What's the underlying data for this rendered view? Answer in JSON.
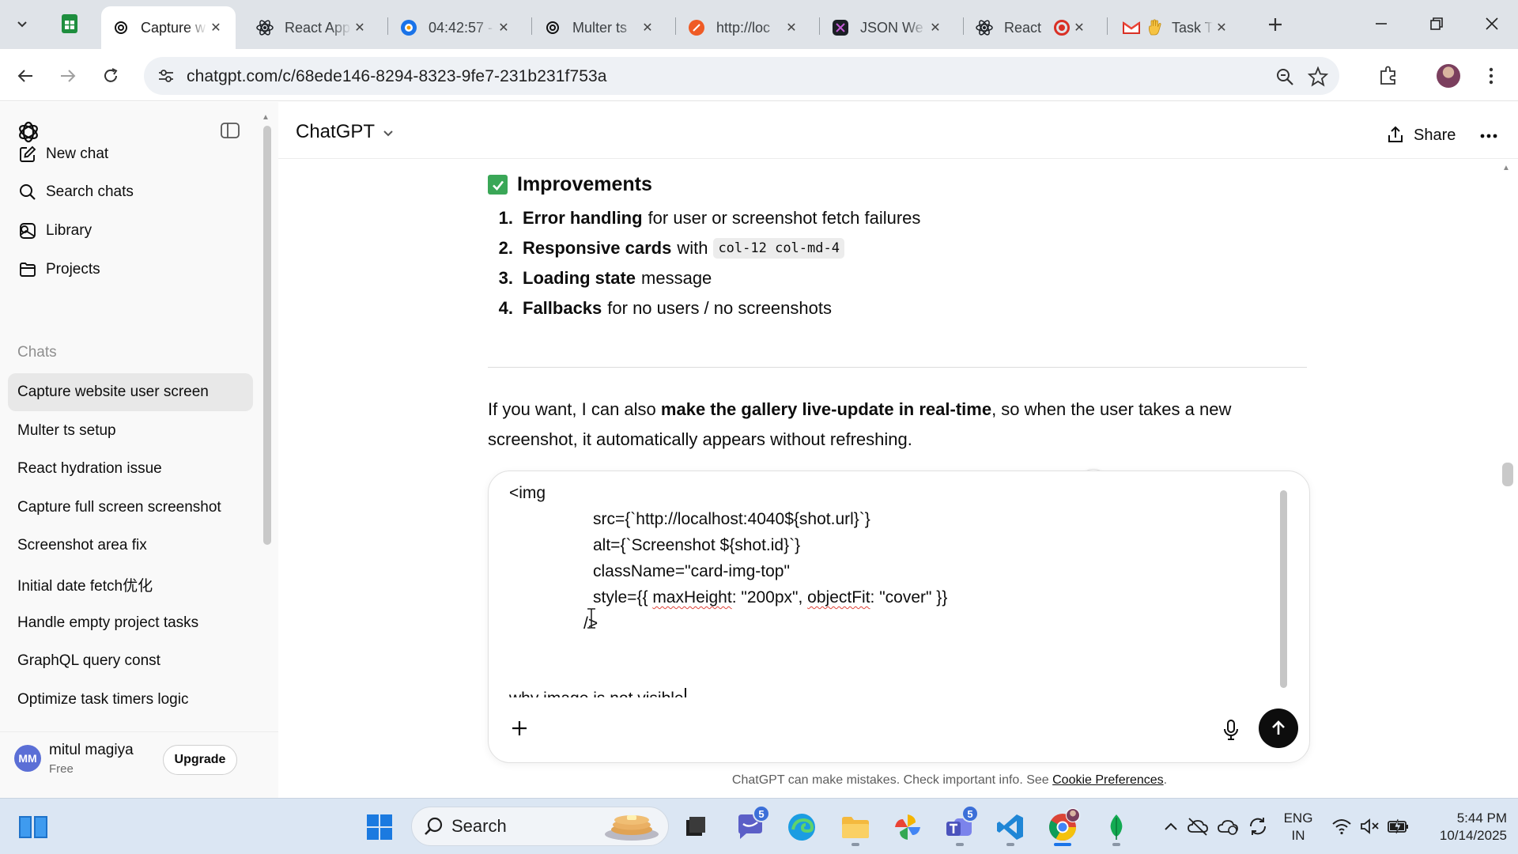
{
  "browser": {
    "tabs": [
      {
        "title": "Capture w",
        "active": true
      },
      {
        "title": "React App",
        "active": false
      },
      {
        "title": "04:42:57 -",
        "active": false
      },
      {
        "title": "Multer ts",
        "active": false
      },
      {
        "title": "http://loc",
        "active": false
      },
      {
        "title": "JSON We",
        "active": false
      },
      {
        "title": "React",
        "active": false
      },
      {
        "title": "Task T",
        "active": false
      }
    ],
    "url": "chatgpt.com/c/68ede146-8294-8323-9fe7-231b231f753a"
  },
  "sidebar": {
    "nav": [
      {
        "label": "New chat",
        "icon": "compose-icon"
      },
      {
        "label": "Search chats",
        "icon": "search-icon"
      },
      {
        "label": "Library",
        "icon": "library-icon"
      },
      {
        "label": "Projects",
        "icon": "folder-icon"
      }
    ],
    "section_label": "Chats",
    "chats": [
      {
        "label": "Capture website user screen",
        "active": true
      },
      {
        "label": "Multer ts setup",
        "active": false
      },
      {
        "label": "React hydration issue",
        "active": false
      },
      {
        "label": "Capture full screen screenshot",
        "active": false
      },
      {
        "label": "Screenshot area fix",
        "active": false
      },
      {
        "label": "Initial date fetch优化",
        "active": false
      },
      {
        "label": "Handle empty project tasks",
        "active": false
      },
      {
        "label": "GraphQL query const",
        "active": false
      },
      {
        "label": "Optimize task timers logic",
        "active": false
      }
    ],
    "user": {
      "initials": "MM",
      "name": "mitul magiya",
      "plan": "Free",
      "upgrade_label": "Upgrade"
    }
  },
  "header": {
    "model": "ChatGPT",
    "share_label": "Share"
  },
  "message": {
    "improvements_heading": "Improvements",
    "items": [
      {
        "num": "1.",
        "bold": "Error handling",
        "rest": "for user or screenshot fetch failures",
        "code": ""
      },
      {
        "num": "2.",
        "bold": "Responsive cards",
        "rest": "with",
        "code": "col-12 col-md-4"
      },
      {
        "num": "3.",
        "bold": "Loading state",
        "rest": "message",
        "code": ""
      },
      {
        "num": "4.",
        "bold": "Fallbacks",
        "rest": "for no users / no screenshots",
        "code": ""
      }
    ],
    "para_pre": "If you want, I can also ",
    "para_bold": "make the gallery live-update in real-time",
    "para_post": ", so when the user takes a new screenshot, it automatically appears without refreshing."
  },
  "composer": {
    "lines": [
      "<img",
      "src={`http://localhost:4040${shot.url}`}",
      "alt={`Screenshot ${shot.id}`}",
      "className=\"card-img-top\"",
      "style={{ ",
      "maxHeight",
      ": \"200px\", ",
      "objectFit",
      ": \"cover\" }}",
      "/>"
    ],
    "question": "why image is not visible"
  },
  "disclaimer": {
    "text": "ChatGPT can make mistakes. Check important info. See ",
    "link": "Cookie Preferences",
    "end": "."
  },
  "taskbar": {
    "search_label": "Search",
    "badges": {
      "chat": "5",
      "teams": "5"
    },
    "lang_line1": "ENG",
    "lang_line2": "IN",
    "time": "5:44 PM",
    "date": "10/14/2025"
  },
  "colors": {
    "accent_green": "#3aa757",
    "send_button": "#0d0d0d",
    "tabstrip": "#dfe3e8",
    "taskbar": "#dbe6f3"
  }
}
